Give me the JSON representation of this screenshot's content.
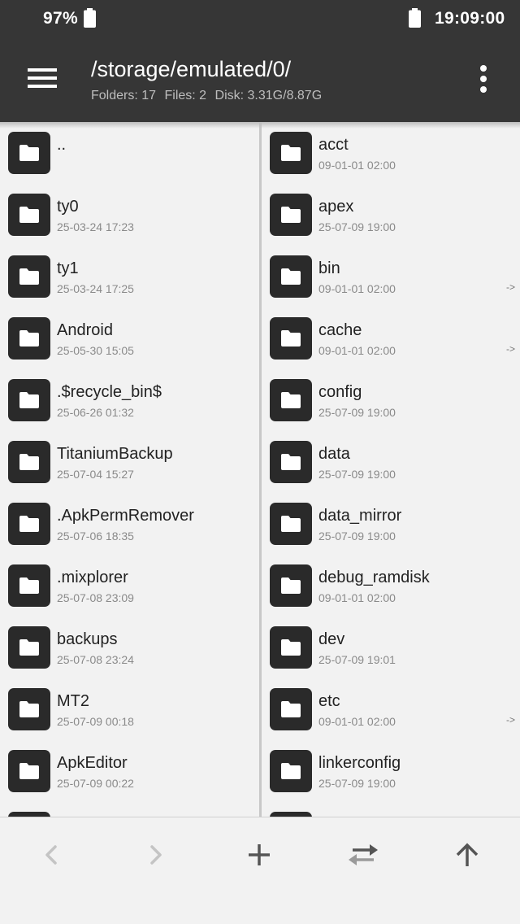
{
  "status_bar": {
    "battery_percent": "97%",
    "clock": "19:09:00",
    "icons": [
      "battery-icon",
      "battery-icon"
    ]
  },
  "app_bar": {
    "path": "/storage/emulated/0/",
    "stats": {
      "folders": "Folders: 17",
      "files": "Files: 2",
      "disk": "Disk: 3.31G/8.87G"
    },
    "icons": [
      "hamburger-menu-icon",
      "more-vert-icon"
    ]
  },
  "left_pane": {
    "items": [
      {
        "name": "..",
        "date": ""
      },
      {
        "name": "ty0",
        "date": "25-03-24 17:23"
      },
      {
        "name": "ty1",
        "date": "25-03-24 17:25"
      },
      {
        "name": "Android",
        "date": "25-05-30 15:05"
      },
      {
        "name": ".$recycle_bin$",
        "date": "25-06-26 01:32"
      },
      {
        "name": "TitaniumBackup",
        "date": "25-07-04 15:27"
      },
      {
        "name": ".ApkPermRemover",
        "date": "25-07-06 18:35"
      },
      {
        "name": ".mixplorer",
        "date": "25-07-08 23:09"
      },
      {
        "name": "backups",
        "date": "25-07-08 23:24"
      },
      {
        "name": "MT2",
        "date": "25-07-09 00:18"
      },
      {
        "name": "ApkEditor",
        "date": "25-07-09 00:22"
      }
    ]
  },
  "right_pane": {
    "items": [
      {
        "name": "acct",
        "date": "09-01-01 02:00",
        "link": ""
      },
      {
        "name": "apex",
        "date": "25-07-09 19:00",
        "link": ""
      },
      {
        "name": "bin",
        "date": "09-01-01 02:00",
        "link": "->"
      },
      {
        "name": "cache",
        "date": "09-01-01 02:00",
        "link": "->"
      },
      {
        "name": "config",
        "date": "25-07-09 19:00",
        "link": ""
      },
      {
        "name": "data",
        "date": "25-07-09 19:00",
        "link": ""
      },
      {
        "name": "data_mirror",
        "date": "25-07-09 19:00",
        "link": ""
      },
      {
        "name": "debug_ramdisk",
        "date": "09-01-01 02:00",
        "link": ""
      },
      {
        "name": "dev",
        "date": "25-07-09 19:01",
        "link": ""
      },
      {
        "name": "etc",
        "date": "09-01-01 02:00",
        "link": "->"
      },
      {
        "name": "linkerconfig",
        "date": "25-07-09 19:00",
        "link": ""
      }
    ]
  },
  "toolbar": {
    "buttons": [
      "back-arrow-icon",
      "forward-arrow-icon",
      "add-icon",
      "swap-panes-icon",
      "go-up-icon"
    ]
  },
  "colors": {
    "app_bar": "#363636",
    "folder_tile": "#2a2a2a",
    "background": "#f2f2f2"
  }
}
